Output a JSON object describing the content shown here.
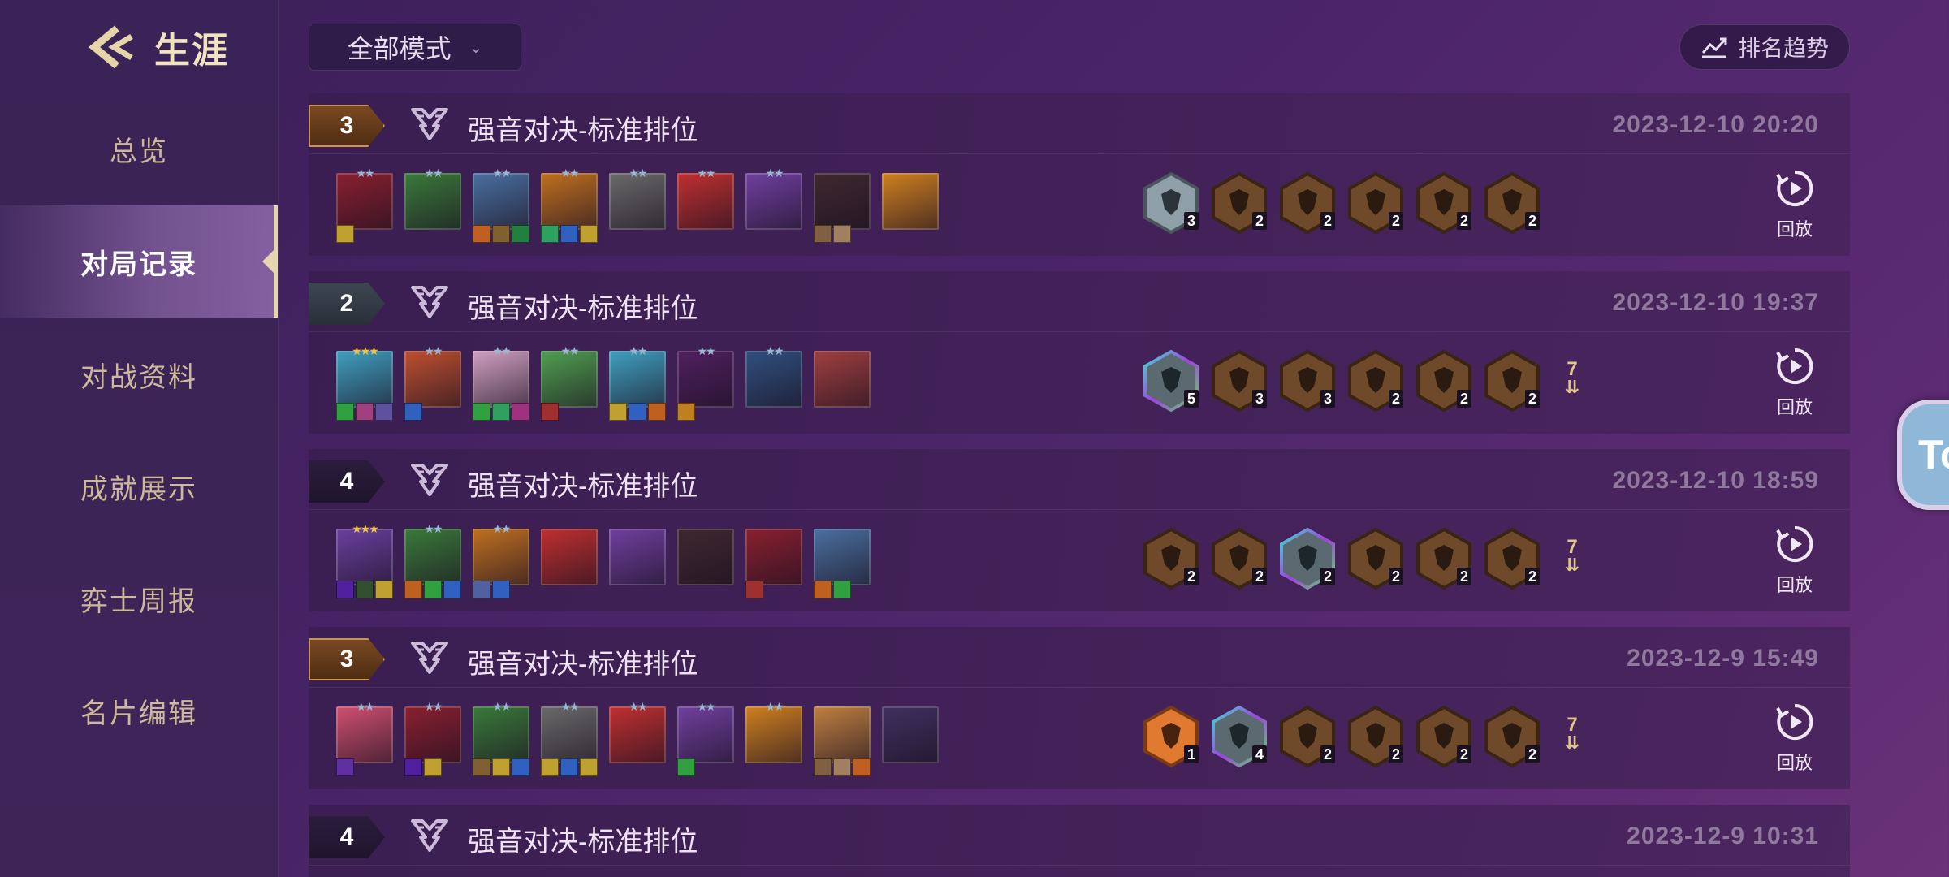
{
  "sidebar": {
    "title": "生涯",
    "items": [
      {
        "label": "总览"
      },
      {
        "label": "对局记录",
        "active": true
      },
      {
        "label": "对战资料"
      },
      {
        "label": "成就展示"
      },
      {
        "label": "弈士周报"
      },
      {
        "label": "名片编辑"
      }
    ]
  },
  "topbar": {
    "mode_select": "全部模式",
    "rank_trend": "排名趋势"
  },
  "replay_label": "回放",
  "matches": [
    {
      "placement": "3",
      "placement_color": "gold",
      "mode": "强音对决-标准排位",
      "time": "2023-12-10 20:20",
      "champions": [
        {
          "stars": 2,
          "color": "#8a2030",
          "items": [
            "#c0a030"
          ]
        },
        {
          "stars": 2,
          "color": "#3a7a3a",
          "items": []
        },
        {
          "stars": 2,
          "color": "#4a70a0",
          "items": [
            "#c06020",
            "#806030",
            "#208040"
          ]
        },
        {
          "stars": 2,
          "color": "#c07020",
          "items": [
            "#30a060",
            "#3060c0",
            "#c0a030"
          ]
        },
        {
          "stars": 2,
          "color": "#6a6a6a",
          "items": []
        },
        {
          "stars": 2,
          "color": "#c03030",
          "items": []
        },
        {
          "stars": 2,
          "color": "#7040a0",
          "items": []
        },
        {
          "stars": 0,
          "color": "#402830",
          "items": [
            "#806040",
            "#a08060"
          ]
        },
        {
          "stars": 0,
          "color": "#d08020",
          "items": []
        }
      ],
      "traits": [
        {
          "tier": "silver",
          "count": "3"
        },
        {
          "tier": "bronze",
          "count": "2"
        },
        {
          "tier": "bronze",
          "count": "2"
        },
        {
          "tier": "bronze",
          "count": "2"
        },
        {
          "tier": "bronze",
          "count": "2"
        },
        {
          "tier": "bronze",
          "count": "2"
        }
      ],
      "more": ""
    },
    {
      "placement": "2",
      "placement_color": "silver",
      "mode": "强音对决-标准排位",
      "time": "2023-12-10 19:37",
      "champions": [
        {
          "stars": 3,
          "color": "#40a0c0",
          "items": [
            "#30a040",
            "#a04080",
            "#6050a0"
          ]
        },
        {
          "stars": 2,
          "color": "#c05030",
          "items": [
            "#3060c0"
          ]
        },
        {
          "stars": 2,
          "color": "#d0a0c0",
          "items": [
            "#30a040",
            "#30a060",
            "#a03080"
          ]
        },
        {
          "stars": 2,
          "color": "#50a050",
          "items": [
            "#a03030"
          ]
        },
        {
          "stars": 2,
          "color": "#40a0c0",
          "items": [
            "#c0a030",
            "#3060c0",
            "#c06020"
          ]
        },
        {
          "stars": 2,
          "color": "#502060",
          "items": [
            "#c08020"
          ]
        },
        {
          "stars": 2,
          "color": "#305080",
          "items": []
        },
        {
          "stars": 0,
          "color": "#a04040",
          "items": []
        }
      ],
      "traits": [
        {
          "tier": "prismatic",
          "count": "5"
        },
        {
          "tier": "bronze",
          "count": "3"
        },
        {
          "tier": "bronze",
          "count": "3"
        },
        {
          "tier": "bronze",
          "count": "2"
        },
        {
          "tier": "bronze",
          "count": "2"
        },
        {
          "tier": "bronze",
          "count": "2"
        }
      ],
      "more": "7"
    },
    {
      "placement": "4",
      "placement_color": "dark",
      "mode": "强音对决-标准排位",
      "time": "2023-12-10 18:59",
      "champions": [
        {
          "stars": 3,
          "color": "#6a40a0",
          "items": [
            "#5020a0",
            "#305030",
            "#c0a030"
          ]
        },
        {
          "stars": 2,
          "color": "#3a7a3a",
          "items": [
            "#c06020",
            "#30a040",
            "#3060c0"
          ]
        },
        {
          "stars": 2,
          "color": "#c07020",
          "items": [
            "#5060a0",
            "#3060c0"
          ]
        },
        {
          "stars": 0,
          "color": "#c03030",
          "items": []
        },
        {
          "stars": 0,
          "color": "#7040a0",
          "items": []
        },
        {
          "stars": 0,
          "color": "#402830",
          "items": []
        },
        {
          "stars": 0,
          "color": "#8a2030",
          "items": [
            "#a03030"
          ]
        },
        {
          "stars": 0,
          "color": "#4a70a0",
          "items": [
            "#c06020",
            "#30a040"
          ]
        }
      ],
      "traits": [
        {
          "tier": "bronze",
          "count": "2"
        },
        {
          "tier": "bronze",
          "count": "2"
        },
        {
          "tier": "prismatic",
          "count": "2"
        },
        {
          "tier": "bronze",
          "count": "2"
        },
        {
          "tier": "bronze",
          "count": "2"
        },
        {
          "tier": "bronze",
          "count": "2"
        }
      ],
      "more": "7"
    },
    {
      "placement": "3",
      "placement_color": "gold",
      "mode": "强音对决-标准排位",
      "time": "2023-12-9 15:49",
      "champions": [
        {
          "stars": 2,
          "color": "#d05070",
          "items": [
            "#6030a0"
          ]
        },
        {
          "stars": 2,
          "color": "#8a2030",
          "items": [
            "#5020a0",
            "#c0a030"
          ]
        },
        {
          "stars": 2,
          "color": "#3a7a3a",
          "items": [
            "#806030",
            "#c0a030",
            "#3060c0"
          ]
        },
        {
          "stars": 2,
          "color": "#6a6a6a",
          "items": [
            "#c0a030",
            "#3060c0",
            "#c0a030"
          ]
        },
        {
          "stars": 2,
          "color": "#c03030",
          "items": []
        },
        {
          "stars": 2,
          "color": "#7040a0",
          "items": [
            "#30a040"
          ]
        },
        {
          "stars": 2,
          "color": "#d08020",
          "items": []
        },
        {
          "stars": 0,
          "color": "#c08040",
          "items": [
            "#806040",
            "#a08060",
            "#c06020"
          ]
        },
        {
          "stars": 0,
          "color": "#403060",
          "items": []
        }
      ],
      "traits": [
        {
          "tier": "orange",
          "count": "1"
        },
        {
          "tier": "prismatic",
          "count": "4"
        },
        {
          "tier": "bronze",
          "count": "2"
        },
        {
          "tier": "bronze",
          "count": "2"
        },
        {
          "tier": "bronze",
          "count": "2"
        },
        {
          "tier": "bronze",
          "count": "2"
        }
      ],
      "more": "7"
    },
    {
      "placement": "4",
      "placement_color": "dark",
      "mode": "强音对决-标准排位",
      "time": "2023-12-9 10:31",
      "champions": [],
      "traits": [],
      "more": ""
    }
  ],
  "float_bubble": "To"
}
